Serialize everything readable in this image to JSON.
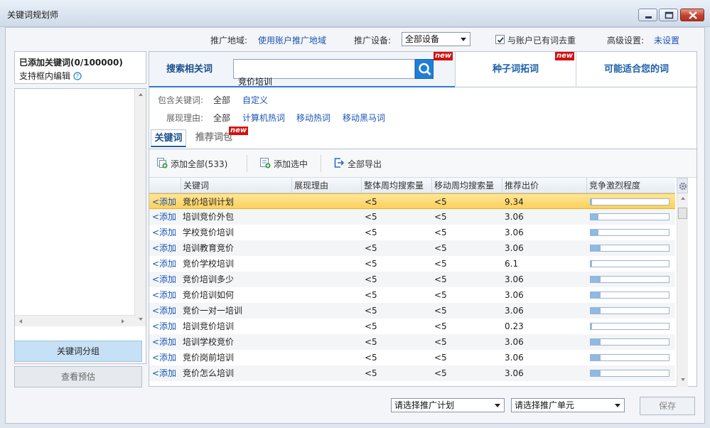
{
  "window": {
    "title": "关键词规划师"
  },
  "settings": {
    "region_label": "推广地域:",
    "region_value": "使用账户推广地域",
    "device_label": "推广设备:",
    "device_value": "全部设备",
    "dedupe_label": "与账户已有词去重",
    "dedupe_checked": true,
    "advanced_label": "高级设置:",
    "advanced_value": "未设置"
  },
  "left": {
    "added_title": "已添加关键词(0/100000)",
    "edit_hint": "支持框内编辑",
    "group_button": "关键词分组",
    "preview_button": "查看预估"
  },
  "search": {
    "tab_related": "搜索相关词",
    "query": "竞价培训",
    "tab_seed": "种子词拓词",
    "tab_suggest": "可能适合您的词",
    "new_badge": "new"
  },
  "filters": {
    "include_label": "包含关键词:",
    "include_all": "全部",
    "include_custom": "自定义",
    "reason_label": "展现理由:",
    "reason_all": "全部",
    "reason_pc_hot": "计算机热词",
    "reason_mobile_hot": "移动热词",
    "reason_mobile_dark": "移动黑马词"
  },
  "tabs": {
    "keywords": "关键词",
    "packages": "推荐词包"
  },
  "toolbar": {
    "add_all": "添加全部(533)",
    "add_selected": "添加选中",
    "export_all": "全部导出"
  },
  "table": {
    "columns": [
      "关键词",
      "展现理由",
      "整体周均搜索量",
      "移动周均搜索量",
      "推荐出价",
      "竞争激烈程度"
    ],
    "add_label": "<添加",
    "rows": [
      {
        "keyword": "竞价培训计划",
        "reason": "",
        "total": "<5",
        "mobile": "<5",
        "bid": "9.34",
        "competition": 0.02
      },
      {
        "keyword": "培训竞价外包",
        "reason": "",
        "total": "<5",
        "mobile": "<5",
        "bid": "3.06",
        "competition": 0.1
      },
      {
        "keyword": "学校竞价培训",
        "reason": "",
        "total": "<5",
        "mobile": "<5",
        "bid": "3.06",
        "competition": 0.1
      },
      {
        "keyword": "培训教育竞价",
        "reason": "",
        "total": "<5",
        "mobile": "<5",
        "bid": "3.06",
        "competition": 0.13
      },
      {
        "keyword": "竞价学校培训",
        "reason": "",
        "total": "<5",
        "mobile": "<5",
        "bid": "6.1",
        "competition": 0.02
      },
      {
        "keyword": "竞价培训多少",
        "reason": "",
        "total": "<5",
        "mobile": "<5",
        "bid": "3.06",
        "competition": 0.13
      },
      {
        "keyword": "竞价培训如何",
        "reason": "",
        "total": "<5",
        "mobile": "<5",
        "bid": "3.06",
        "competition": 0.13
      },
      {
        "keyword": "竞价一对一培训",
        "reason": "",
        "total": "<5",
        "mobile": "<5",
        "bid": "3.06",
        "competition": 0.13
      },
      {
        "keyword": "培训竞价培训",
        "reason": "",
        "total": "<5",
        "mobile": "<5",
        "bid": "0.23",
        "competition": 0.02
      },
      {
        "keyword": "培训学校竞价",
        "reason": "",
        "total": "<5",
        "mobile": "<5",
        "bid": "3.06",
        "competition": 0.13
      },
      {
        "keyword": "竞价岗前培训",
        "reason": "",
        "total": "<5",
        "mobile": "<5",
        "bid": "3.06",
        "competition": 0.13
      },
      {
        "keyword": "竞价怎么培训",
        "reason": "",
        "total": "<5",
        "mobile": "<5",
        "bid": "3.06",
        "competition": 0.13
      }
    ]
  },
  "bottom": {
    "plan_select": "请选择推广计划",
    "unit_select": "请选择推广单元",
    "save_button": "保存"
  },
  "colors": {
    "accent": "#1f7fd6",
    "link": "#1a55b5",
    "selected_row": "#fbd05c",
    "new_badge": "#d3100f"
  }
}
